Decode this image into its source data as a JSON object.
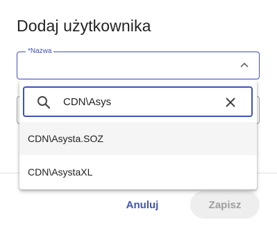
{
  "dialog": {
    "title": "Dodaj użytkownika",
    "field_label": "*Nazwa",
    "cancel_label": "Anuluj",
    "save_label": "Zapisz"
  },
  "dropdown": {
    "search_value": "CDN\\Asys",
    "options": [
      {
        "label": "CDN\\Asysta.SOZ"
      },
      {
        "label": "CDN\\AsystaXL"
      }
    ]
  },
  "colors": {
    "accent": "#3f51b5",
    "disabled_bg": "#eeeeee",
    "disabled_text": "#9e9e9e"
  },
  "icons": [
    "chevron-up-icon",
    "search-icon",
    "close-icon"
  ]
}
